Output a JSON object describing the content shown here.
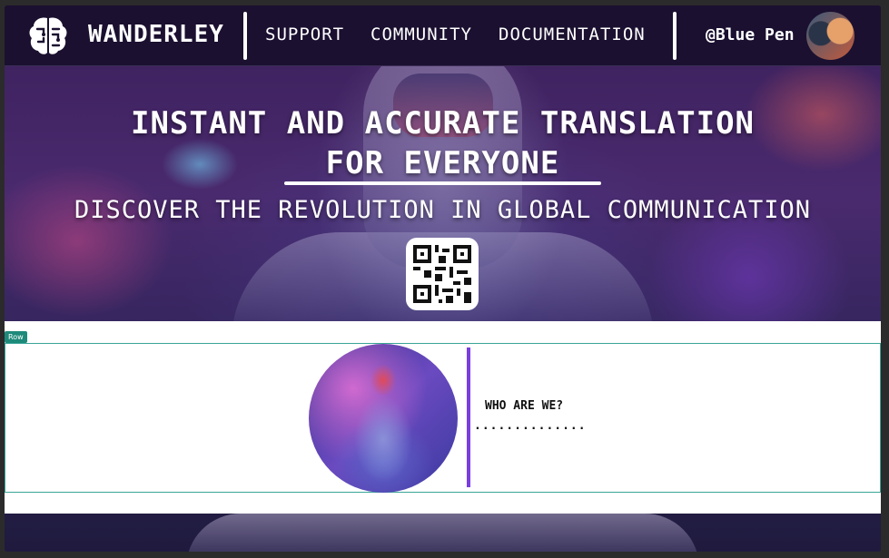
{
  "navbar": {
    "brand": "WANDERLEY",
    "links": [
      "SUPPORT",
      "COMMUNITY",
      "DOCUMENTATION"
    ],
    "username": "@Blue Pen",
    "brand_icon": "brain-icon"
  },
  "hero": {
    "title_line1": "INSTANT AND ACCURATE TRANSLATION",
    "title_line2": "FOR EVERYONE",
    "subtitle": "DISCOVER THE REVOLUTION IN GLOBAL COMMUNICATION",
    "qr_icon": "qr-code-icon"
  },
  "about": {
    "row_label": "Row",
    "heading": "WHO ARE WE?",
    "text": ".............."
  },
  "colors": {
    "nav_bg": "#1b1030",
    "accent_purple": "#7a3ee0",
    "row_outline": "#3aa596"
  }
}
